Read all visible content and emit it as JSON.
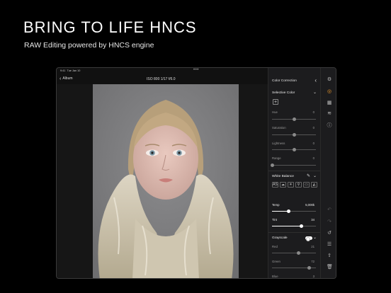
{
  "headline": "BRING TO LIFE HNCS",
  "subhead": "RAW Editing powered by HNCS engine",
  "status": {
    "time": "9:41",
    "date": "Tue Jan 10",
    "battery": "100%"
  },
  "topbar": {
    "back_label": "Album",
    "meta": "ISO 800  1/17  f/6.0"
  },
  "panel": {
    "title": "Color Correction",
    "selective": {
      "title": "Selective Color",
      "sliders": [
        {
          "label": "Hue",
          "value": "0",
          "level": 0.5
        },
        {
          "label": "Saturation",
          "value": "0",
          "level": 0.5
        },
        {
          "label": "Lightness",
          "value": "0",
          "level": 0.5
        },
        {
          "label": "Range",
          "value": "0",
          "level": 0.0
        }
      ]
    },
    "white_balance": {
      "title": "White Balance",
      "presets": [
        "AS",
        "☁",
        "☀",
        "⚲",
        "▭",
        "◭"
      ],
      "sliders": [
        {
          "label": "Temp",
          "value": "5,000k",
          "level": 0.38
        },
        {
          "label": "Tint",
          "value": "34",
          "level": 0.67
        }
      ]
    },
    "grayscale": {
      "title": "Grayscale",
      "sliders": [
        {
          "label": "Red",
          "value": "21",
          "level": 0.6
        },
        {
          "label": "Green",
          "value": "72",
          "level": 0.85
        },
        {
          "label": "Blue",
          "value": "3",
          "level": 0.5
        }
      ]
    }
  },
  "tools": [
    "settings-icon",
    "color-icon",
    "adjust-icon",
    "curves-icon",
    "info-icon",
    "undo-icon",
    "redo-icon",
    "reset-icon",
    "list-icon",
    "share-icon",
    "trash-icon"
  ]
}
